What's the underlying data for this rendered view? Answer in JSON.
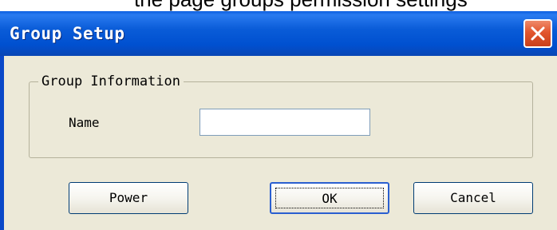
{
  "background_text": "the page groups permission settings",
  "window": {
    "title": "Group Setup",
    "close_icon": "close-icon"
  },
  "group_information": {
    "legend": "Group Information",
    "name_label": "Name",
    "name_value": ""
  },
  "buttons": {
    "power": "Power",
    "ok": "OK",
    "cancel": "Cancel"
  },
  "colors": {
    "titlebar": "#0054e3",
    "dialog_background": "#ece9d8",
    "close_button": "#e2562e",
    "button_border": "#003c74"
  }
}
